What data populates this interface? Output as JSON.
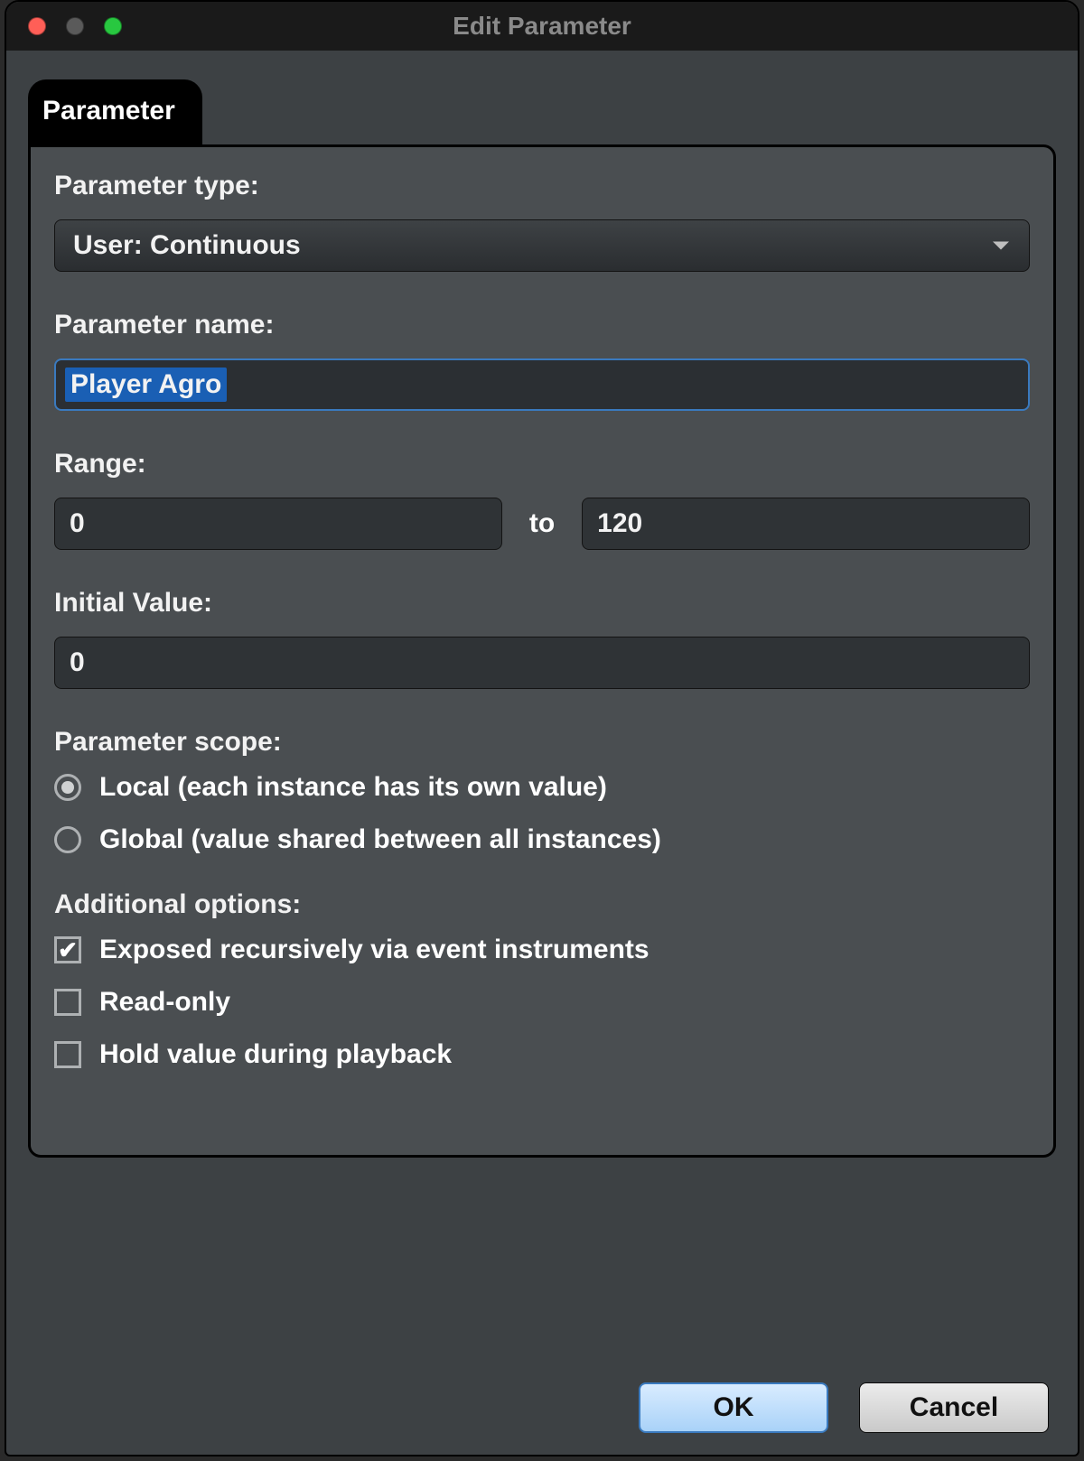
{
  "window": {
    "title": "Edit Parameter"
  },
  "tab": {
    "label": "Parameter"
  },
  "labels": {
    "parameter_type": "Parameter type:",
    "parameter_name": "Parameter name:",
    "range": "Range:",
    "range_sep": "to",
    "initial_value": "Initial Value:",
    "scope": "Parameter scope:",
    "additional": "Additional options:"
  },
  "fields": {
    "parameter_type_value": "User: Continuous",
    "parameter_name_value": "Player Agro",
    "range_min": "0",
    "range_max": "120",
    "initial_value": "0"
  },
  "scope_options": {
    "local": "Local (each instance has its own value)",
    "global": "Global (value shared between all instances)",
    "selected": "local"
  },
  "additional_options": {
    "exposed": {
      "label": "Exposed recursively via event instruments",
      "checked": true
    },
    "readonly": {
      "label": "Read-only",
      "checked": false
    },
    "hold": {
      "label": "Hold value during playback",
      "checked": false
    }
  },
  "buttons": {
    "ok": "OK",
    "cancel": "Cancel"
  }
}
